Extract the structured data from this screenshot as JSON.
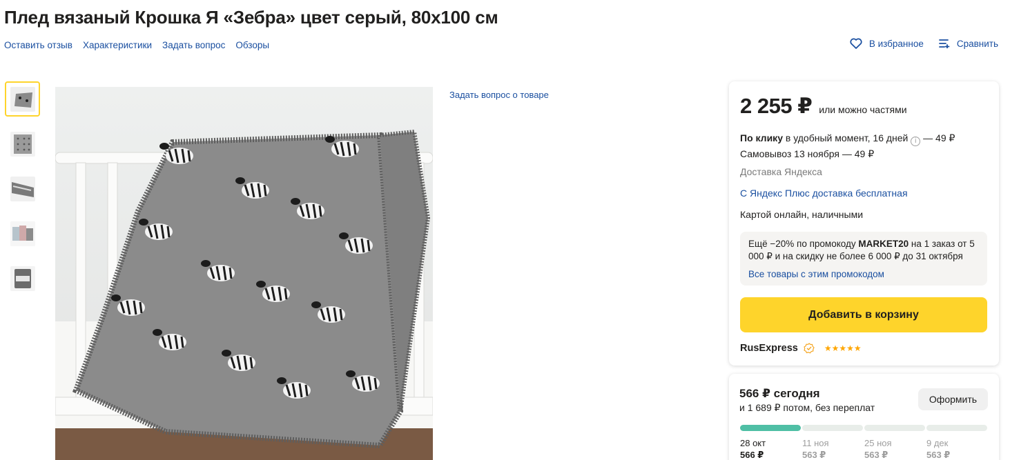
{
  "product": {
    "title": "Плед вязаный Крошка Я «Зебра» цвет серый, 80х100 см"
  },
  "nav_links": [
    "Оставить отзыв",
    "Характеристики",
    "Задать вопрос",
    "Обзоры"
  ],
  "actions": {
    "favorite_label": "В избранное",
    "compare_label": "Сравнить"
  },
  "gallery": {
    "thumbnails": [
      "blanket-thumb-1",
      "blanket-thumb-2",
      "blanket-thumb-3",
      "blanket-thumb-4",
      "blanket-thumb-5"
    ],
    "active_index": 0
  },
  "ask_question_label": "Задать вопрос о товаре",
  "buy_box": {
    "price": "2 255 ₽",
    "price_note": "или можно частями",
    "delivery_courier_bold": "По клику",
    "delivery_courier_rest": "в удобный момент, 16 дней",
    "delivery_courier_price": "— 49 ₽",
    "delivery_pickup": "Самовывоз 13 ноября — 49 ₽",
    "delivery_provider": "Доставка Яндекса",
    "plus_delivery": "С Яндекс Плюс доставка бесплатная",
    "payment_methods": "Картой онлайн, наличными",
    "promo": {
      "text_before": "Ещё −20% по промокоду",
      "code": "MARKET20",
      "text_after": "на 1 заказ от 5 000 ₽ и на скидку не более 6 000 ₽ до 31 октября",
      "link": "Все товары с этим промокодом"
    },
    "add_to_cart": "Добавить в корзину",
    "seller": "RusExpress",
    "rating_stars": "★★★★★",
    "colors": {
      "accent_yellow": "#fed42b",
      "link_blue": "#1a4fa0",
      "split_green": "#4fbfa5"
    }
  },
  "split": {
    "title": "566 ₽ сегодня",
    "subtitle": "и 1 689 ₽ потом, без переплат",
    "checkout_label": "Оформить",
    "payments": [
      {
        "date": "28 окт",
        "amount": "566 ₽",
        "paid": true
      },
      {
        "date": "11 ноя",
        "amount": "563 ₽",
        "paid": false
      },
      {
        "date": "25 ноя",
        "amount": "563 ₽",
        "paid": false
      },
      {
        "date": "9 дек",
        "amount": "563 ₽",
        "paid": false
      }
    ]
  }
}
